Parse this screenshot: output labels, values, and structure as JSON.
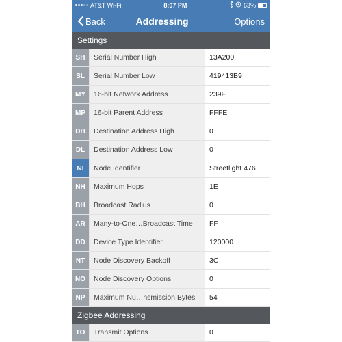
{
  "status": {
    "carrier": "AT&T Wi-Fi",
    "time": "8:07 PM",
    "bt_icon": "bluetooth-icon",
    "orientation_icon": "orientation-lock-icon",
    "battery_pct": "63%"
  },
  "nav": {
    "back": "Back",
    "title": "Addressing",
    "options": "Options"
  },
  "sections": [
    {
      "header": "Settings",
      "rows": [
        {
          "code": "SH",
          "name": "Serial Number High",
          "value": "13A200"
        },
        {
          "code": "SL",
          "name": "Serial Number Low",
          "value": "419413B9"
        },
        {
          "code": "MY",
          "name": "16-bit Network Address",
          "value": "239F"
        },
        {
          "code": "MP",
          "name": "16-bit Parent Address",
          "value": "FFFE"
        },
        {
          "code": "DH",
          "name": "Destination Address High",
          "value": "0"
        },
        {
          "code": "DL",
          "name": "Destination Address Low",
          "value": "0"
        },
        {
          "code": "NI",
          "name": "Node Identifier",
          "value": "Streetlight 476",
          "highlight": true
        },
        {
          "code": "NH",
          "name": "Maximum Hops",
          "value": "1E"
        },
        {
          "code": "BH",
          "name": "Broadcast Radius",
          "value": "0"
        },
        {
          "code": "AR",
          "name": "Many-to-One…Broadcast Time",
          "value": "FF"
        },
        {
          "code": "DD",
          "name": "Device Type Identifier",
          "value": "120000"
        },
        {
          "code": "NT",
          "name": "Node Discovery Backoff",
          "value": "3C"
        },
        {
          "code": "NO",
          "name": "Node Discovery Options",
          "value": "0"
        },
        {
          "code": "NP",
          "name": "Maximum Nu…nsmission Bytes",
          "value": "54"
        }
      ]
    },
    {
      "header": "Zigbee Addressing",
      "rows": [
        {
          "code": "TO",
          "name": "Transmit Options",
          "value": "0"
        }
      ]
    }
  ],
  "colors": {
    "accent": "#477db4",
    "codebox": "#9aa1a8",
    "group": "#54585c"
  }
}
